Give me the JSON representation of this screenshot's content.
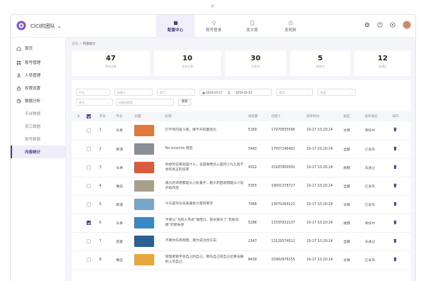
{
  "team_name": "CiCi的团队",
  "top_nav": [
    {
      "label": "配置中心",
      "active": true
    },
    {
      "label": "账号登录",
      "active": false
    },
    {
      "label": "发文章",
      "active": false
    },
    {
      "label": "发视频",
      "active": false
    }
  ],
  "sidebar": [
    {
      "label": "首页",
      "icon": "home-icon",
      "sub": false,
      "active": false
    },
    {
      "label": "账号管理",
      "icon": "grid-icon",
      "sub": false,
      "active": false
    },
    {
      "label": "人员管理",
      "icon": "user-icon",
      "sub": false,
      "active": false
    },
    {
      "label": "权限设置",
      "icon": "lock-icon",
      "sub": false,
      "active": false
    },
    {
      "label": "数据分析",
      "icon": "chart-icon",
      "sub": false,
      "active": false
    },
    {
      "label": "平台数据",
      "icon": "",
      "sub": true,
      "active": false
    },
    {
      "label": "员工数据",
      "icon": "",
      "sub": true,
      "active": false
    },
    {
      "label": "账号数据",
      "icon": "",
      "sub": true,
      "active": false
    },
    {
      "label": "内容统计",
      "icon": "",
      "sub": true,
      "active": true
    }
  ],
  "breadcrumb": {
    "root": "首页",
    "current": "内容统计"
  },
  "stats": [
    {
      "value": "47",
      "label": "发布总数"
    },
    {
      "value": "10",
      "label": "发布文章"
    },
    {
      "value": "30",
      "label": "已发布"
    },
    {
      "value": "5",
      "label": "审核中"
    },
    {
      "value": "12",
      "label": "未通过"
    }
  ],
  "filters": {
    "platform": "平台",
    "creator": "创建人",
    "department": "部门",
    "date_start": "2019-10-17",
    "date_to": "至",
    "date_end": "2019-10-22",
    "type": "类型",
    "status": "状态",
    "account": "账号",
    "keyword": "关键词搜索",
    "search": "搜索"
  },
  "table": {
    "headers": [
      "序号",
      "平台",
      "封面",
      "标题",
      "阅读量",
      "创建人",
      "发布时间",
      "类型",
      "发布状态",
      "操作"
    ],
    "rows": [
      {
        "idx": "1",
        "platform": "头条",
        "title": "打不死的奋斗者，哪不开的曼变化",
        "reads": "5169",
        "creator": "17970655596",
        "time": "10-17 10:20:24",
        "type": "文章",
        "status": "审核中",
        "checked": false,
        "thumb": "#e07a3a"
      },
      {
        "idx": "2",
        "platform": "新浪",
        "title": "No surprise 原因",
        "reads": "5493",
        "creator": "17937246402",
        "time": "10-17 10:20:24",
        "type": "全部",
        "status": "已发布",
        "checked": false,
        "thumb": "#8a8f97"
      },
      {
        "idx": "3",
        "platform": "头条",
        "title": "你想的实质就是什么，总是做更多心里的小九九就不会有真正的伤害",
        "reads": "4502",
        "creator": "15187800500",
        "time": "10-17 10:20:24",
        "type": "视频",
        "status": "未通过",
        "checked": false,
        "thumb": "#d95a3c"
      },
      {
        "idx": "4",
        "platform": "微信",
        "title": "再大的诱惑都是从小处着手，越大的困境都是从小处开始改变",
        "reads": "5055",
        "creator": "19001378727",
        "time": "10-17 10:20:24",
        "type": "全部",
        "status": "已发布",
        "checked": false,
        "thumb": "#a8a08c"
      },
      {
        "idx": "5",
        "platform": "新浪",
        "title": "今天是你对未来最有力量的要求",
        "reads": "7068",
        "creator": "13470264122",
        "time": "10-17 10:20:24",
        "type": "文章",
        "status": "已发布",
        "checked": false,
        "thumb": "#7aa5c7"
      },
      {
        "idx": "6",
        "platform": "头条",
        "title": "不要以“为别人考虑”做借口，就买某天了“老板风靡”的使命感",
        "reads": "5286",
        "creator": "13335932137",
        "time": "10-17 10:20:24",
        "type": "视频",
        "status": "审核中",
        "checked": true,
        "thumb": "#3a88c8"
      },
      {
        "idx": "7",
        "platform": "百家",
        "title": "不要你先有刚需，要为成功找方向",
        "reads": "2347",
        "creator": "13129574512",
        "time": "10-17 10:20:24",
        "type": "全部",
        "status": "未通过",
        "checked": false,
        "thumb": "#2c5f93"
      },
      {
        "idx": "8",
        "platform": "微信",
        "title": "管理者要学会自己的自己，那先自己的自己还要去跟别人的自己",
        "reads": "8439",
        "creator": "15982676155",
        "time": "10-17 10:20:24",
        "type": "文章",
        "status": "已发布",
        "checked": false,
        "thumb": "#e8a63d"
      }
    ]
  },
  "colors": {
    "accent": "#4b3a8f",
    "delete": "#4b3a8f"
  }
}
